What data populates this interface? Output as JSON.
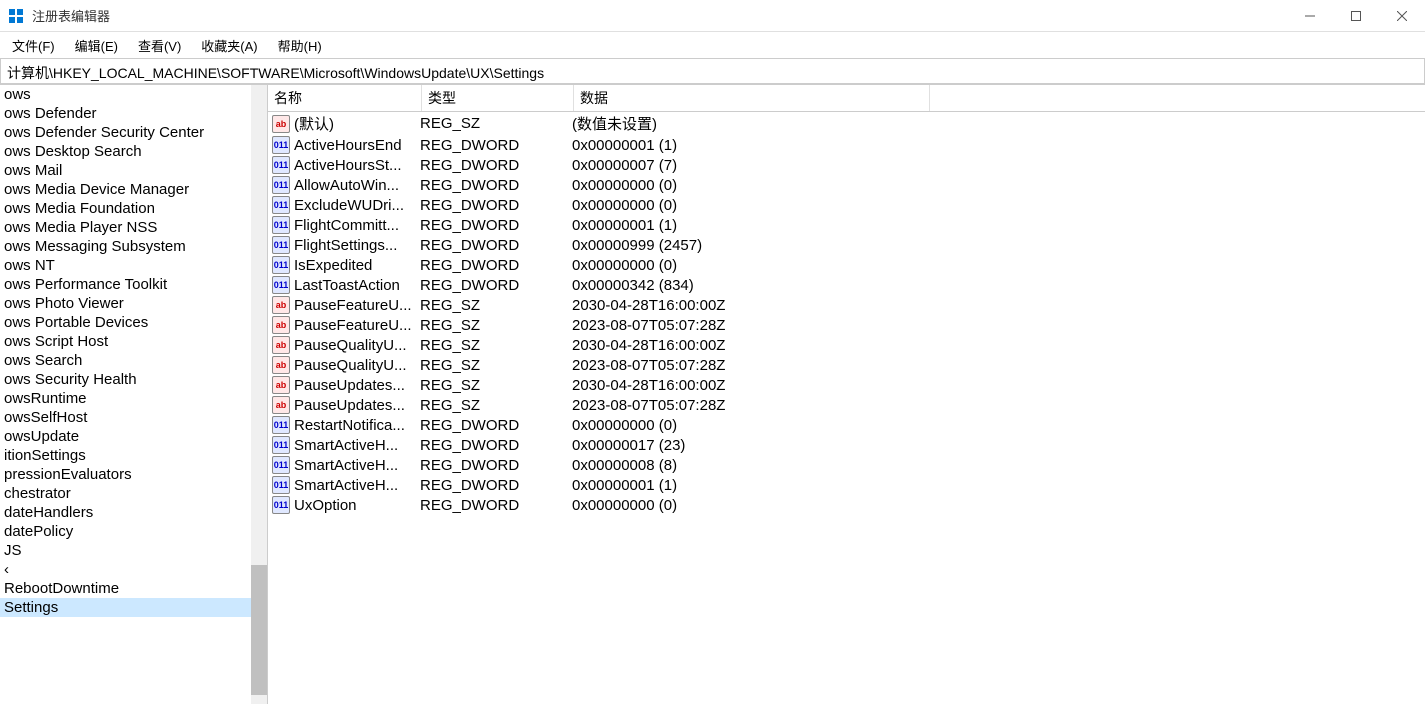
{
  "window": {
    "title": "注册表编辑器"
  },
  "menu": {
    "file": "文件(F)",
    "edit": "编辑(E)",
    "view": "查看(V)",
    "favorites": "收藏夹(A)",
    "help": "帮助(H)"
  },
  "address": "计算机\\HKEY_LOCAL_MACHINE\\SOFTWARE\\Microsoft\\WindowsUpdate\\UX\\Settings",
  "columns": {
    "name": "名称",
    "type": "类型",
    "data": "数据"
  },
  "tree": [
    "ows",
    "ows Defender",
    "ows Defender Security Center",
    "ows Desktop Search",
    "ows Mail",
    "ows Media Device Manager",
    "ows Media Foundation",
    "ows Media Player NSS",
    "ows Messaging Subsystem",
    "ows NT",
    "ows Performance Toolkit",
    "ows Photo Viewer",
    "ows Portable Devices",
    "ows Script Host",
    "ows Search",
    "ows Security Health",
    "owsRuntime",
    "owsSelfHost",
    "owsUpdate",
    "itionSettings",
    "pressionEvaluators",
    "chestrator",
    "dateHandlers",
    "datePolicy",
    "JS",
    "‹",
    "RebootDowntime",
    "Settings"
  ],
  "tree_selected_index": 27,
  "values": [
    {
      "icon": "sz",
      "name": "(默认)",
      "type": "REG_SZ",
      "data": "(数值未设置)"
    },
    {
      "icon": "dw",
      "name": "ActiveHoursEnd",
      "type": "REG_DWORD",
      "data": "0x00000001 (1)"
    },
    {
      "icon": "dw",
      "name": "ActiveHoursSt...",
      "type": "REG_DWORD",
      "data": "0x00000007 (7)"
    },
    {
      "icon": "dw",
      "name": "AllowAutoWin...",
      "type": "REG_DWORD",
      "data": "0x00000000 (0)"
    },
    {
      "icon": "dw",
      "name": "ExcludeWUDri...",
      "type": "REG_DWORD",
      "data": "0x00000000 (0)"
    },
    {
      "icon": "dw",
      "name": "FlightCommitt...",
      "type": "REG_DWORD",
      "data": "0x00000001 (1)"
    },
    {
      "icon": "dw",
      "name": "FlightSettings...",
      "type": "REG_DWORD",
      "data": "0x00000999 (2457)"
    },
    {
      "icon": "dw",
      "name": "IsExpedited",
      "type": "REG_DWORD",
      "data": "0x00000000 (0)"
    },
    {
      "icon": "dw",
      "name": "LastToastAction",
      "type": "REG_DWORD",
      "data": "0x00000342 (834)"
    },
    {
      "icon": "sz",
      "name": "PauseFeatureU...",
      "type": "REG_SZ",
      "data": "2030-04-28T16:00:00Z"
    },
    {
      "icon": "sz",
      "name": "PauseFeatureU...",
      "type": "REG_SZ",
      "data": "2023-08-07T05:07:28Z"
    },
    {
      "icon": "sz",
      "name": "PauseQualityU...",
      "type": "REG_SZ",
      "data": "2030-04-28T16:00:00Z"
    },
    {
      "icon": "sz",
      "name": "PauseQualityU...",
      "type": "REG_SZ",
      "data": "2023-08-07T05:07:28Z"
    },
    {
      "icon": "sz",
      "name": "PauseUpdates...",
      "type": "REG_SZ",
      "data": "2030-04-28T16:00:00Z"
    },
    {
      "icon": "sz",
      "name": "PauseUpdates...",
      "type": "REG_SZ",
      "data": "2023-08-07T05:07:28Z"
    },
    {
      "icon": "dw",
      "name": "RestartNotifica...",
      "type": "REG_DWORD",
      "data": "0x00000000 (0)"
    },
    {
      "icon": "dw",
      "name": "SmartActiveH...",
      "type": "REG_DWORD",
      "data": "0x00000017 (23)"
    },
    {
      "icon": "dw",
      "name": "SmartActiveH...",
      "type": "REG_DWORD",
      "data": "0x00000008 (8)"
    },
    {
      "icon": "dw",
      "name": "SmartActiveH...",
      "type": "REG_DWORD",
      "data": "0x00000001 (1)"
    },
    {
      "icon": "dw",
      "name": "UxOption",
      "type": "REG_DWORD",
      "data": "0x00000000 (0)"
    }
  ]
}
